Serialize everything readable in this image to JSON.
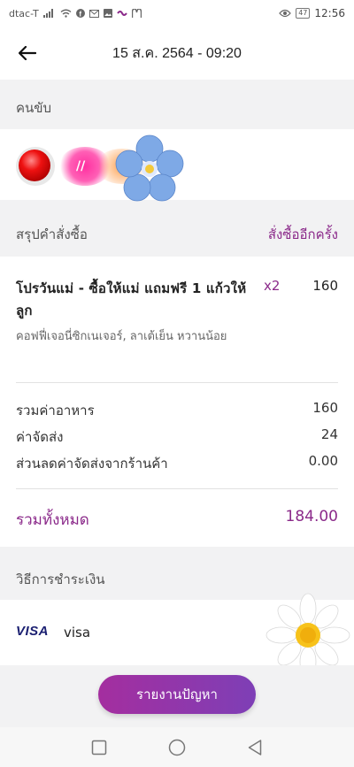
{
  "status_bar": {
    "carrier": "dtac-T",
    "battery": "47",
    "time": "12:56"
  },
  "header": {
    "title": "15 ส.ค. 2564 - 09:20"
  },
  "driver_section": {
    "title": "คนขับ"
  },
  "order_section": {
    "title": "สรุปคำสั่งซื้อ",
    "reorder_label": "สั่งซื้ออีกครั้ง",
    "item": {
      "name": "โปรวันแม่ - ซื้อให้แม่ แถมฟรี 1 แก้วให้ลูก",
      "qty": "x2",
      "price": "160",
      "options": "คอฟฟี่เจอนี่ซิกเนเจอร์, ลาเต้เย็น หวานน้อย"
    },
    "subtotal_label": "รวมค่าอาหาร",
    "subtotal_value": "160",
    "delivery_label": "ค่าจัดส่ง",
    "delivery_value": "24",
    "discount_label": "ส่วนลดค่าจัดส่งจากร้านค้า",
    "discount_value": "0.00",
    "total_label": "รวมทั้งหมด",
    "total_value": "184.00"
  },
  "payment_section": {
    "title": "วิธีการชำระเงิน",
    "card_logo": "VISA",
    "card_label": "visa"
  },
  "report_button": {
    "label": "รายงานปัญหา"
  },
  "colors": {
    "accent": "#8b2a8a",
    "button_start": "#a42e9f",
    "button_end": "#7e3fb6",
    "background": "#f2f2f3"
  },
  "icons": {
    "back": "arrow-left-icon",
    "nav_recent": "square-icon",
    "nav_home": "circle-icon",
    "nav_back": "triangle-icon"
  }
}
